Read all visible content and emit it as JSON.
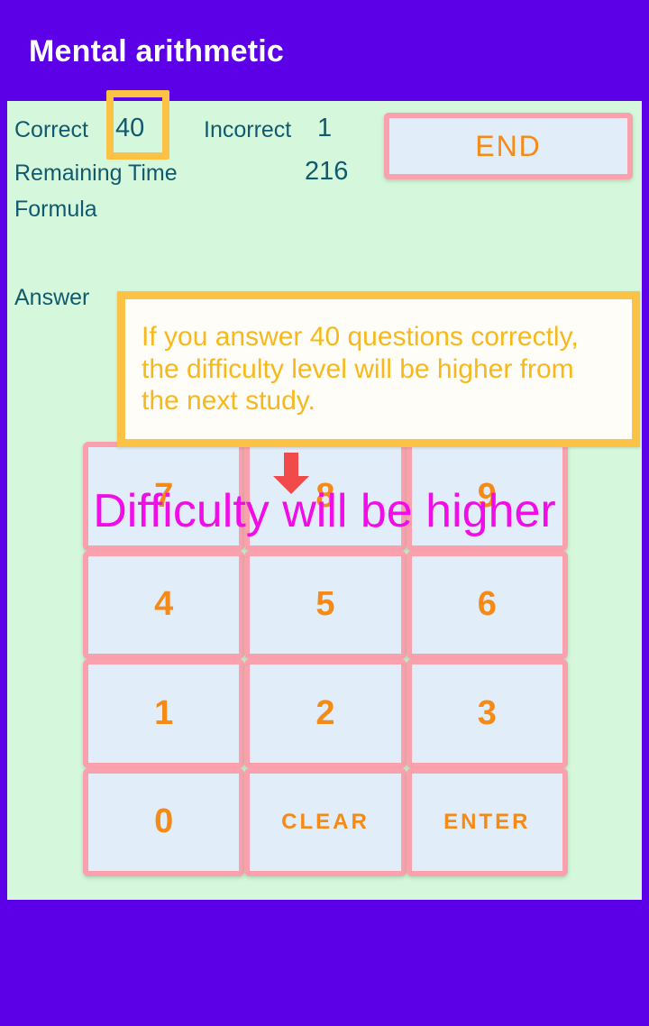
{
  "app": {
    "title": "Mental arithmetic",
    "header_bg": "#5c00e8",
    "panel_bg": "#d5f8dc"
  },
  "stats": {
    "correct_label": "Correct",
    "correct_value": "40",
    "incorrect_label": "Incorrect",
    "incorrect_value": "1",
    "remaining_time_label": "Remaining Time",
    "remaining_time_value": "216",
    "formula_label": "Formula",
    "formula_value": "",
    "answer_label": "Answer",
    "answer_value": "",
    "text_color": "#115a6d"
  },
  "end_button": {
    "label": "END",
    "text_color": "#f58a17",
    "fill": "#e2edfa",
    "border": "#fba0ad"
  },
  "highlight": {
    "target": "correct-value",
    "color": "#fcc245"
  },
  "hint": {
    "text": "If you answer 40 questions correctly, the difficulty level will be higher from the next study.",
    "border_color": "#fcc245",
    "text_color": "#f6b91d",
    "fill": "#fffdf7"
  },
  "arrow": {
    "direction": "down",
    "color": "#f04a4a",
    "icon": "arrow-down-icon"
  },
  "notice": {
    "text": "Difficulty will be higher",
    "color": "#f20ce8"
  },
  "keypad": {
    "fill": "#e2edfa",
    "border": "#fba0ad",
    "text_color": "#f58a17",
    "keys": [
      {
        "label": "7",
        "name": "key-7",
        "type": "digit"
      },
      {
        "label": "8",
        "name": "key-8",
        "type": "digit"
      },
      {
        "label": "9",
        "name": "key-9",
        "type": "digit"
      },
      {
        "label": "4",
        "name": "key-4",
        "type": "digit"
      },
      {
        "label": "5",
        "name": "key-5",
        "type": "digit"
      },
      {
        "label": "6",
        "name": "key-6",
        "type": "digit"
      },
      {
        "label": "1",
        "name": "key-1",
        "type": "digit"
      },
      {
        "label": "2",
        "name": "key-2",
        "type": "digit"
      },
      {
        "label": "3",
        "name": "key-3",
        "type": "digit"
      },
      {
        "label": "0",
        "name": "key-0",
        "type": "digit"
      },
      {
        "label": "CLEAR",
        "name": "key-clear",
        "type": "word"
      },
      {
        "label": "ENTER",
        "name": "key-enter",
        "type": "word"
      }
    ]
  }
}
